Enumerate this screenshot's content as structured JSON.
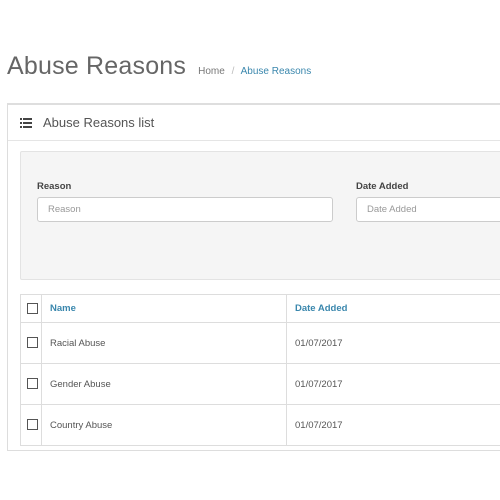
{
  "header": {
    "title": "Abuse Reasons",
    "breadcrumb": [
      {
        "label": "Home"
      },
      {
        "label": "Abuse Reasons"
      }
    ],
    "breadcrumb_separator": "/"
  },
  "panel": {
    "icon": "list-icon",
    "title": "Abuse Reasons list"
  },
  "filters": {
    "reason": {
      "label": "Reason",
      "placeholder": "Reason",
      "value": ""
    },
    "date_added": {
      "label": "Date Added",
      "placeholder": "Date Added",
      "value": ""
    }
  },
  "table": {
    "columns": [
      "Name",
      "Date Added"
    ],
    "rows": [
      {
        "name": "Racial Abuse",
        "date_added": "01/07/2017",
        "checked": false
      },
      {
        "name": "Gender Abuse",
        "date_added": "01/07/2017",
        "checked": false
      },
      {
        "name": "Country Abuse",
        "date_added": "01/07/2017",
        "checked": false
      }
    ]
  },
  "colors": {
    "link": "#3a87ad",
    "title": "#666666"
  }
}
